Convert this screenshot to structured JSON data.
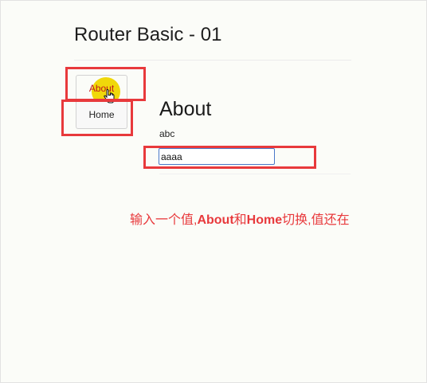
{
  "page": {
    "title": "Router Basic - 01"
  },
  "nav": {
    "about_label": "About",
    "home_label": "Home"
  },
  "content": {
    "heading": "About",
    "text": "abc",
    "input_value": "aaaa"
  },
  "annotation": {
    "part1": "输入一个值,",
    "word_about": "About",
    "part2": "和",
    "word_home": "Home",
    "part3": "切换,值还在"
  },
  "colors": {
    "annotation_red": "#e8393c",
    "click_highlight": "#f0d80a",
    "input_focus_border": "#4a78c9"
  },
  "icons": {
    "cursor": "hand-pointer-icon"
  }
}
